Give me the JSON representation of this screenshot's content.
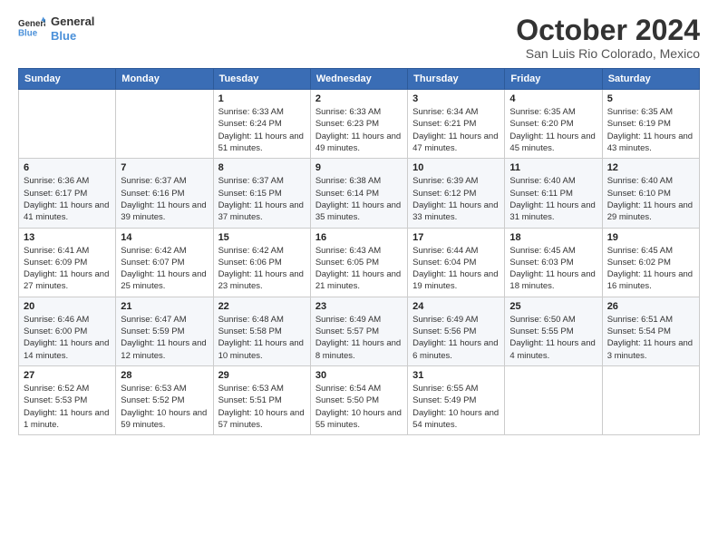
{
  "header": {
    "logo": {
      "line1": "General",
      "line2": "Blue"
    },
    "title": "October 2024",
    "location": "San Luis Rio Colorado, Mexico"
  },
  "weekdays": [
    "Sunday",
    "Monday",
    "Tuesday",
    "Wednesday",
    "Thursday",
    "Friday",
    "Saturday"
  ],
  "weeks": [
    [
      null,
      null,
      {
        "day": "1",
        "sunrise": "Sunrise: 6:33 AM",
        "sunset": "Sunset: 6:24 PM",
        "daylight": "Daylight: 11 hours and 51 minutes."
      },
      {
        "day": "2",
        "sunrise": "Sunrise: 6:33 AM",
        "sunset": "Sunset: 6:23 PM",
        "daylight": "Daylight: 11 hours and 49 minutes."
      },
      {
        "day": "3",
        "sunrise": "Sunrise: 6:34 AM",
        "sunset": "Sunset: 6:21 PM",
        "daylight": "Daylight: 11 hours and 47 minutes."
      },
      {
        "day": "4",
        "sunrise": "Sunrise: 6:35 AM",
        "sunset": "Sunset: 6:20 PM",
        "daylight": "Daylight: 11 hours and 45 minutes."
      },
      {
        "day": "5",
        "sunrise": "Sunrise: 6:35 AM",
        "sunset": "Sunset: 6:19 PM",
        "daylight": "Daylight: 11 hours and 43 minutes."
      }
    ],
    [
      {
        "day": "6",
        "sunrise": "Sunrise: 6:36 AM",
        "sunset": "Sunset: 6:17 PM",
        "daylight": "Daylight: 11 hours and 41 minutes."
      },
      {
        "day": "7",
        "sunrise": "Sunrise: 6:37 AM",
        "sunset": "Sunset: 6:16 PM",
        "daylight": "Daylight: 11 hours and 39 minutes."
      },
      {
        "day": "8",
        "sunrise": "Sunrise: 6:37 AM",
        "sunset": "Sunset: 6:15 PM",
        "daylight": "Daylight: 11 hours and 37 minutes."
      },
      {
        "day": "9",
        "sunrise": "Sunrise: 6:38 AM",
        "sunset": "Sunset: 6:14 PM",
        "daylight": "Daylight: 11 hours and 35 minutes."
      },
      {
        "day": "10",
        "sunrise": "Sunrise: 6:39 AM",
        "sunset": "Sunset: 6:12 PM",
        "daylight": "Daylight: 11 hours and 33 minutes."
      },
      {
        "day": "11",
        "sunrise": "Sunrise: 6:40 AM",
        "sunset": "Sunset: 6:11 PM",
        "daylight": "Daylight: 11 hours and 31 minutes."
      },
      {
        "day": "12",
        "sunrise": "Sunrise: 6:40 AM",
        "sunset": "Sunset: 6:10 PM",
        "daylight": "Daylight: 11 hours and 29 minutes."
      }
    ],
    [
      {
        "day": "13",
        "sunrise": "Sunrise: 6:41 AM",
        "sunset": "Sunset: 6:09 PM",
        "daylight": "Daylight: 11 hours and 27 minutes."
      },
      {
        "day": "14",
        "sunrise": "Sunrise: 6:42 AM",
        "sunset": "Sunset: 6:07 PM",
        "daylight": "Daylight: 11 hours and 25 minutes."
      },
      {
        "day": "15",
        "sunrise": "Sunrise: 6:42 AM",
        "sunset": "Sunset: 6:06 PM",
        "daylight": "Daylight: 11 hours and 23 minutes."
      },
      {
        "day": "16",
        "sunrise": "Sunrise: 6:43 AM",
        "sunset": "Sunset: 6:05 PM",
        "daylight": "Daylight: 11 hours and 21 minutes."
      },
      {
        "day": "17",
        "sunrise": "Sunrise: 6:44 AM",
        "sunset": "Sunset: 6:04 PM",
        "daylight": "Daylight: 11 hours and 19 minutes."
      },
      {
        "day": "18",
        "sunrise": "Sunrise: 6:45 AM",
        "sunset": "Sunset: 6:03 PM",
        "daylight": "Daylight: 11 hours and 18 minutes."
      },
      {
        "day": "19",
        "sunrise": "Sunrise: 6:45 AM",
        "sunset": "Sunset: 6:02 PM",
        "daylight": "Daylight: 11 hours and 16 minutes."
      }
    ],
    [
      {
        "day": "20",
        "sunrise": "Sunrise: 6:46 AM",
        "sunset": "Sunset: 6:00 PM",
        "daylight": "Daylight: 11 hours and 14 minutes."
      },
      {
        "day": "21",
        "sunrise": "Sunrise: 6:47 AM",
        "sunset": "Sunset: 5:59 PM",
        "daylight": "Daylight: 11 hours and 12 minutes."
      },
      {
        "day": "22",
        "sunrise": "Sunrise: 6:48 AM",
        "sunset": "Sunset: 5:58 PM",
        "daylight": "Daylight: 11 hours and 10 minutes."
      },
      {
        "day": "23",
        "sunrise": "Sunrise: 6:49 AM",
        "sunset": "Sunset: 5:57 PM",
        "daylight": "Daylight: 11 hours and 8 minutes."
      },
      {
        "day": "24",
        "sunrise": "Sunrise: 6:49 AM",
        "sunset": "Sunset: 5:56 PM",
        "daylight": "Daylight: 11 hours and 6 minutes."
      },
      {
        "day": "25",
        "sunrise": "Sunrise: 6:50 AM",
        "sunset": "Sunset: 5:55 PM",
        "daylight": "Daylight: 11 hours and 4 minutes."
      },
      {
        "day": "26",
        "sunrise": "Sunrise: 6:51 AM",
        "sunset": "Sunset: 5:54 PM",
        "daylight": "Daylight: 11 hours and 3 minutes."
      }
    ],
    [
      {
        "day": "27",
        "sunrise": "Sunrise: 6:52 AM",
        "sunset": "Sunset: 5:53 PM",
        "daylight": "Daylight: 11 hours and 1 minute."
      },
      {
        "day": "28",
        "sunrise": "Sunrise: 6:53 AM",
        "sunset": "Sunset: 5:52 PM",
        "daylight": "Daylight: 10 hours and 59 minutes."
      },
      {
        "day": "29",
        "sunrise": "Sunrise: 6:53 AM",
        "sunset": "Sunset: 5:51 PM",
        "daylight": "Daylight: 10 hours and 57 minutes."
      },
      {
        "day": "30",
        "sunrise": "Sunrise: 6:54 AM",
        "sunset": "Sunset: 5:50 PM",
        "daylight": "Daylight: 10 hours and 55 minutes."
      },
      {
        "day": "31",
        "sunrise": "Sunrise: 6:55 AM",
        "sunset": "Sunset: 5:49 PM",
        "daylight": "Daylight: 10 hours and 54 minutes."
      },
      null,
      null
    ]
  ]
}
